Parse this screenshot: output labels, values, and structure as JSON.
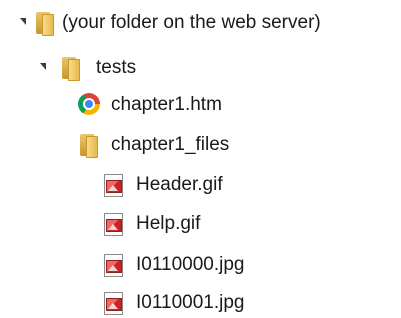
{
  "tree": {
    "items": [
      {
        "label": "(your folder on the web server)",
        "icon": "folder-icon",
        "expanded": true
      },
      {
        "label": "tests",
        "icon": "folder-icon",
        "expanded": true
      },
      {
        "label": "chapter1.htm",
        "icon": "chrome-icon"
      },
      {
        "label": "chapter1_files",
        "icon": "folder-icon"
      },
      {
        "label": "Header.gif",
        "icon": "image-file-icon"
      },
      {
        "label": "Help.gif",
        "icon": "image-file-icon"
      },
      {
        "label": "I0110000.jpg",
        "icon": "image-file-icon"
      },
      {
        "label": "I0110001.jpg",
        "icon": "image-file-icon"
      }
    ]
  }
}
